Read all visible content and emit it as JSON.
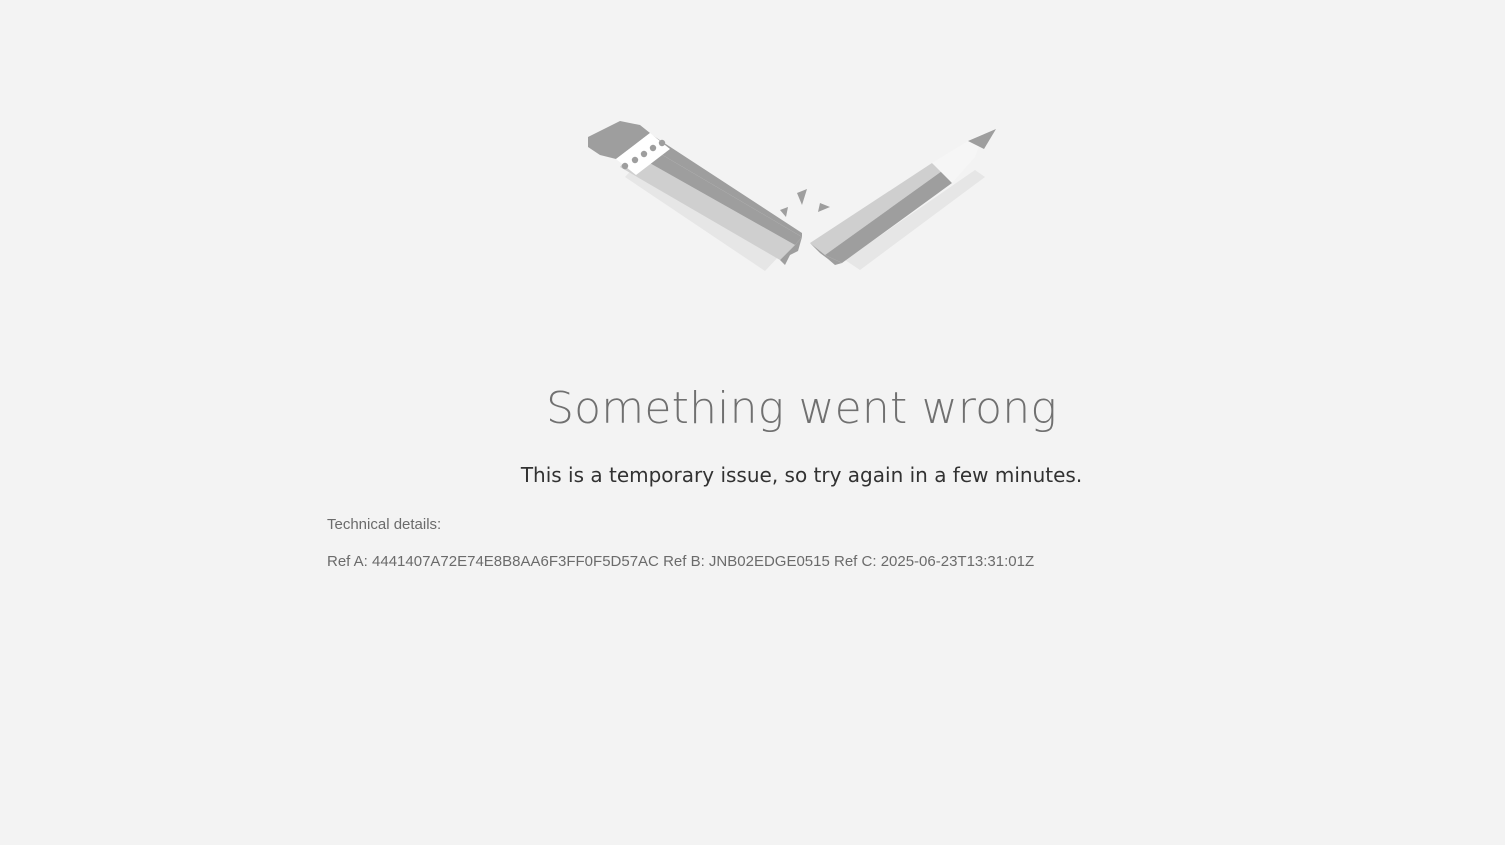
{
  "error": {
    "illustration_icon": "broken-pencil-icon",
    "title": "Something went wrong",
    "message": "This is a temporary issue, so try again in a few minutes.",
    "technical_label": "Technical details:",
    "refs": {
      "ref_a_label": "Ref A:",
      "ref_a_value": "4441407A72E74E8B8AA6F3FF0F5D57AC",
      "ref_b_label": "Ref B:",
      "ref_b_value": "JNB02EDGE0515",
      "ref_c_label": "Ref C:",
      "ref_c_value": "2025-06-23T13:31:01Z"
    }
  },
  "colors": {
    "background": "#f3f3f3",
    "title": "#707070",
    "message": "#323232",
    "details": "#6b6b6b",
    "pencil_dark": "#9e9e9e",
    "pencil_light": "#cfcfcf"
  }
}
